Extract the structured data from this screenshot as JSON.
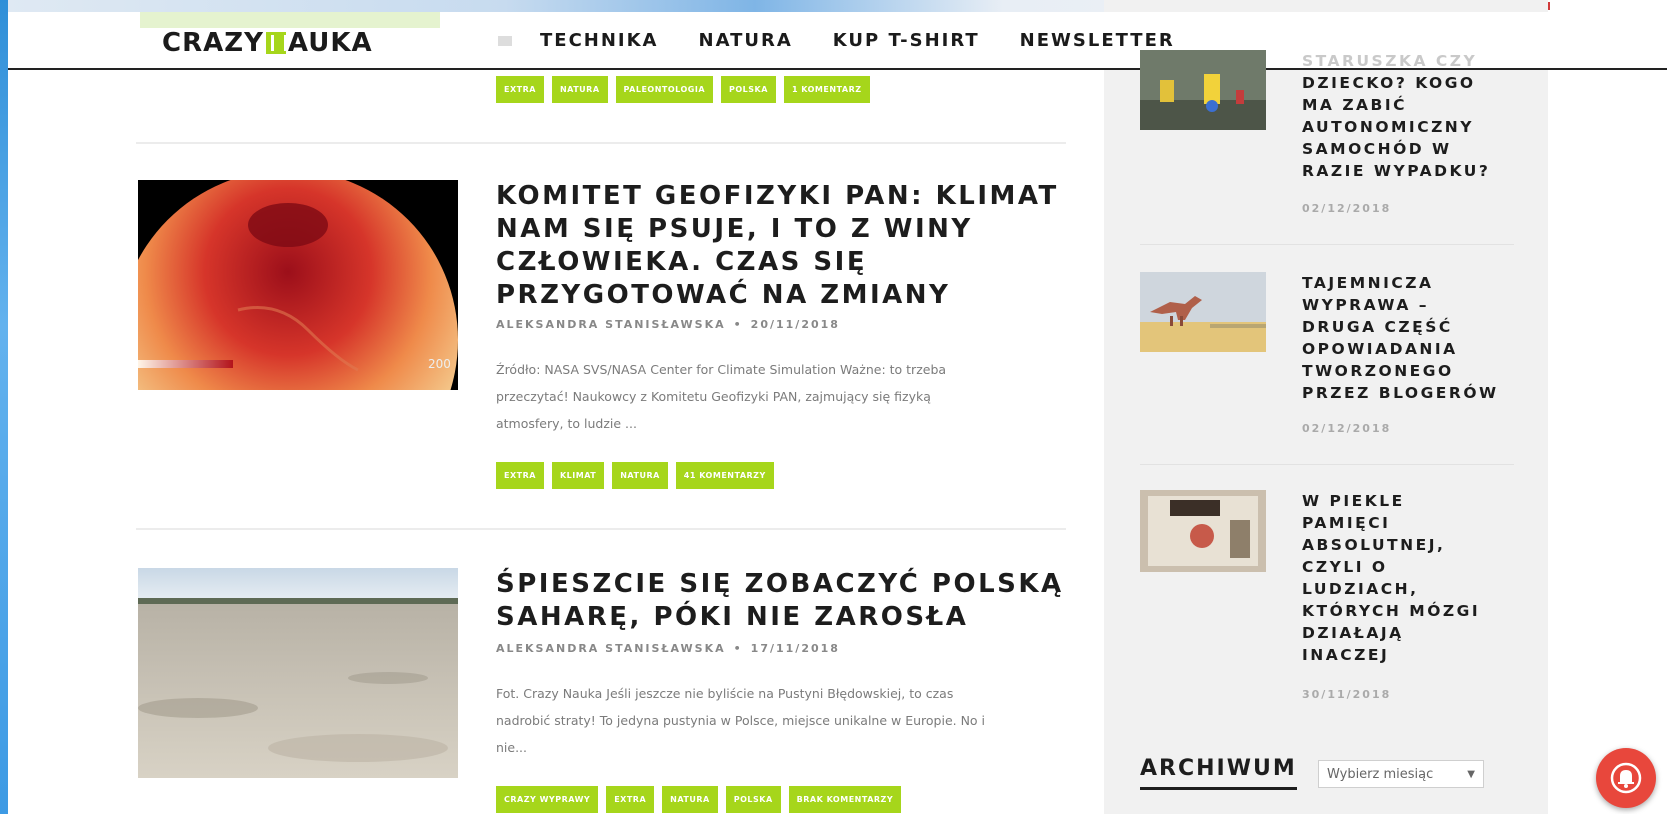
{
  "header": {
    "logo_left": "CRAZY",
    "logo_right": "AUKA",
    "nav": [
      "TECHNIKA",
      "NATURA",
      "KUP T-SHIRT",
      "NEWSLETTER"
    ]
  },
  "top_tags": [
    "EXTRA",
    "NATURA",
    "PALEONTOLOGIA",
    "POLSKA",
    "1 KOMENTARZ"
  ],
  "posts": [
    {
      "title_lines": [
        "KOMITET GEOFIZYKI PAN: KLIMAT",
        "NAM SIĘ PSUJE, I TO Z WINY",
        "CZŁOWIEKA. CZAS SIĘ",
        "PRZYGOTOWAĆ NA ZMIANY"
      ],
      "author": "ALEKSANDRA STANISŁAWSKA",
      "date": "20/11/2018",
      "excerpt_lines": [
        "Źródło: NASA SVS/NASA Center for Climate Simulation Ważne: to trzeba",
        "przeczytać! Naukowcy z Komitetu Geofizyki PAN, zajmujący się fizyką",
        "atmosfery, to ludzie ..."
      ],
      "image_label": "200",
      "tags": [
        "EXTRA",
        "KLIMAT",
        "NATURA",
        "41 KOMENTARZY"
      ]
    },
    {
      "title_lines": [
        "ŚPIESZCIE SIĘ ZOBACZYĆ POLSKĄ",
        "SAHARĘ, PÓKI NIE ZAROSŁA"
      ],
      "author": "ALEKSANDRA STANISŁAWSKA",
      "date": "17/11/2018",
      "excerpt_lines": [
        "Fot. Crazy Nauka Jeśli jeszcze nie byliście na Pustyni Błędowskiej, to czas",
        "nadrobić straty! To jedyna pustynia w Polsce, miejsce unikalne w Europie. No i",
        "nie..."
      ],
      "tags": [
        "CRAZY WYPRAWY",
        "EXTRA",
        "NATURA",
        "POLSKA",
        "BRAK KOMENTARZY"
      ]
    }
  ],
  "sidebar": {
    "items": [
      {
        "title_lines": [
          "STARUSZKA CZY",
          "DZIECKO? KOGO",
          "MA ZABIĆ",
          "AUTONOMICZNY",
          "SAMOCHÓD W",
          "RAZIE WYPADKU?"
        ],
        "date": "02/12/2018"
      },
      {
        "title_lines": [
          "TAJEMNICZA",
          "WYPRAWA –",
          "DRUGA CZĘŚĆ",
          "OPOWIADANIA",
          "TWORZONEGO",
          "PRZEZ BLOGERÓW"
        ],
        "date": "02/12/2018"
      },
      {
        "title_lines": [
          "W PIEKLE",
          "PAMIĘCI",
          "ABSOLUTNEJ,",
          "CZYLI O",
          "LUDZIACH,",
          "KTÓRYCH MÓZGI",
          "DZIAŁAJĄ",
          "INACZEJ"
        ],
        "date": "30/11/2018"
      }
    ],
    "archive_title": "ARCHIWUM",
    "archive_select": "Wybierz miesiąc"
  },
  "colors": {
    "accent": "#a6d61b",
    "notification": "#e8473c"
  }
}
